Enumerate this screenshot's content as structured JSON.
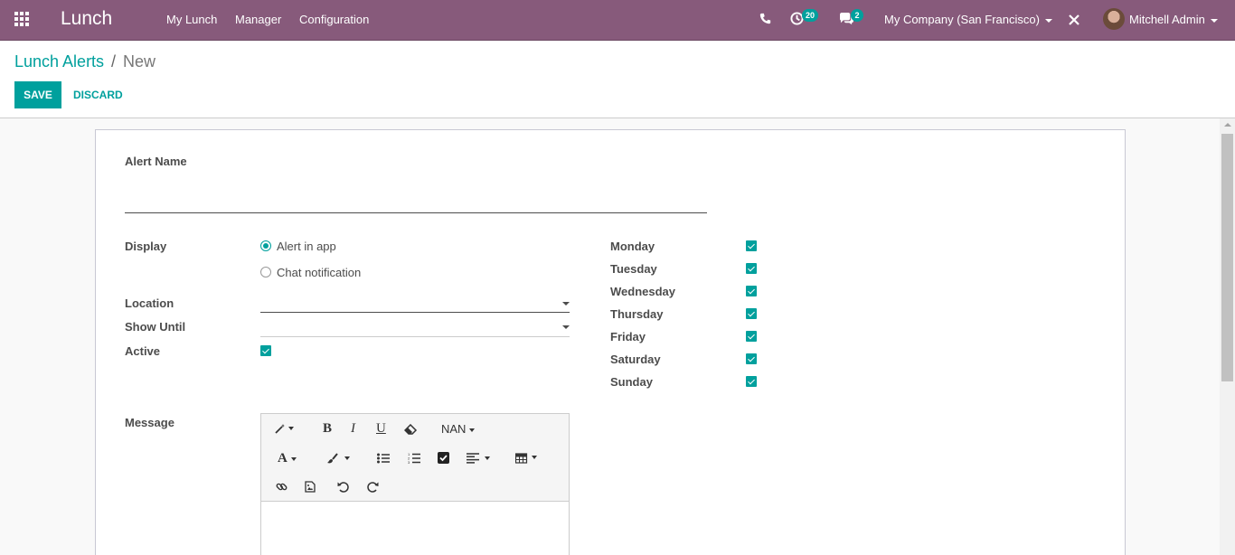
{
  "navbar": {
    "app_title": "Lunch",
    "menu": [
      "My Lunch",
      "Manager",
      "Configuration"
    ],
    "activity_count": "20",
    "messages_count": "2",
    "company": "My Company (San Francisco)",
    "user": "Mitchell Admin"
  },
  "breadcrumb": {
    "parent": "Lunch Alerts",
    "separator": "/",
    "current": "New"
  },
  "actions": {
    "save": "SAVE",
    "discard": "DISCARD"
  },
  "form": {
    "alert_name_label": "Alert Name",
    "alert_name_value": "",
    "display_label": "Display",
    "display_options": [
      {
        "label": "Alert in app",
        "selected": true
      },
      {
        "label": "Chat notification",
        "selected": false
      }
    ],
    "location_label": "Location",
    "location_value": "",
    "show_until_label": "Show Until",
    "show_until_value": "",
    "active_label": "Active",
    "active_checked": true,
    "days": [
      {
        "label": "Monday",
        "checked": true
      },
      {
        "label": "Tuesday",
        "checked": true
      },
      {
        "label": "Wednesday",
        "checked": true
      },
      {
        "label": "Thursday",
        "checked": true
      },
      {
        "label": "Friday",
        "checked": true
      },
      {
        "label": "Saturday",
        "checked": true
      },
      {
        "label": "Sunday",
        "checked": true
      }
    ],
    "message_label": "Message",
    "editor": {
      "font_size": "NAN",
      "content": ""
    }
  },
  "colors": {
    "brand": "#875a7b",
    "accent": "#00a09d"
  }
}
